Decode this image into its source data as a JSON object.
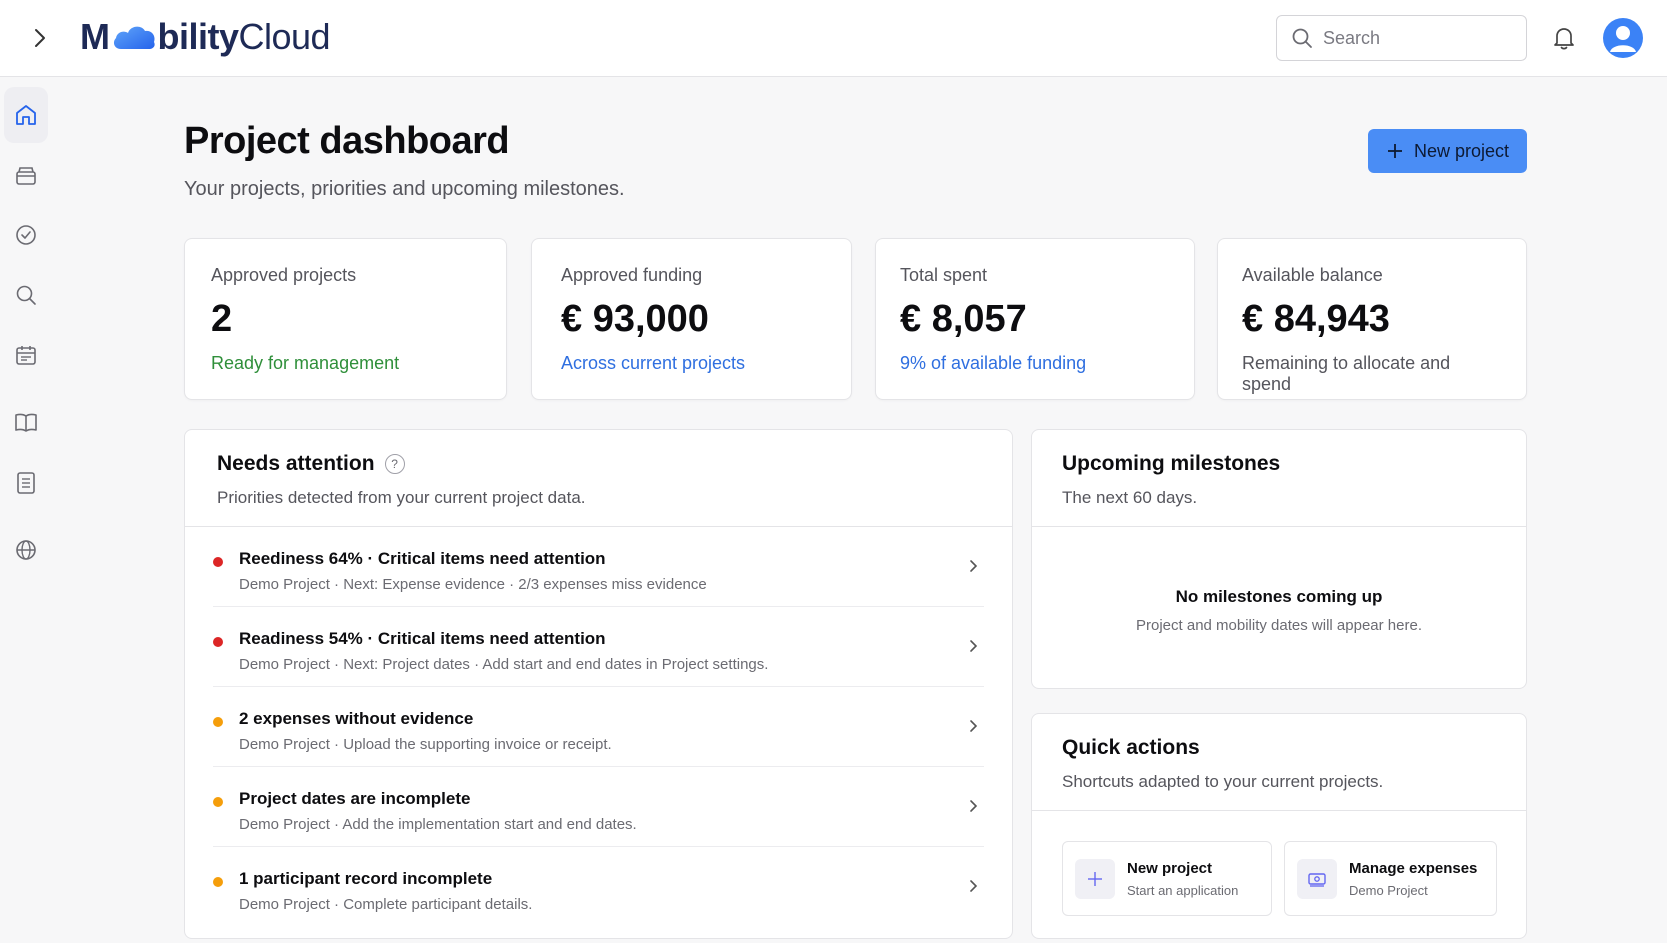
{
  "header": {
    "logo_bold": "M",
    "logo_bold_rest": "bility",
    "logo_light": "Cloud",
    "search_placeholder": "Search"
  },
  "page": {
    "title": "Project dashboard",
    "subtitle": "Your projects, priorities and upcoming milestones.",
    "new_project_label": "New project"
  },
  "stats": [
    {
      "label": "Approved projects",
      "value": "2",
      "note": "Ready for management",
      "note_color": "#2f8f3a"
    },
    {
      "label": "Approved funding",
      "value": "€ 93,000",
      "note": "Across current projects",
      "note_color": "#2f6fe0"
    },
    {
      "label": "Total spent",
      "value": "€ 8,057",
      "note": "9% of available funding",
      "note_color": "#2f6fe0"
    },
    {
      "label": "Available balance",
      "value": "€ 84,943",
      "note": "Remaining to allocate and spend",
      "note_color": "#55555c"
    }
  ],
  "attention": {
    "title": "Needs attention",
    "help": "?",
    "description": "Priorities detected from your current project data.",
    "items": [
      {
        "title": "Reediness 64% · Critical items need attention",
        "meta": "Demo Project · Next: Expense evidence · 2/3 expenses miss evidence",
        "severity_color": "#dc2626"
      },
      {
        "title": "Readiness 54% · Critical items need attention",
        "meta": "Demo Project · Next: Project dates · Add start and end dates in Project settings.",
        "severity_color": "#dc2626"
      },
      {
        "title": "2 expenses without evidence",
        "meta": "Demo Project · Upload the supporting invoice or receipt.",
        "severity_color": "#f59e0b"
      },
      {
        "title": "Project dates are incomplete",
        "meta": "Demo Project · Add the implementation start and end dates.",
        "severity_color": "#f59e0b"
      },
      {
        "title": "1 participant record incomplete",
        "meta": "Demo Project · Complete participant details.",
        "severity_color": "#f59e0b"
      }
    ]
  },
  "milestones": {
    "title": "Upcoming milestones",
    "description": "The next 60 days.",
    "empty_title": "No milestones coming up",
    "empty_desc": "Project and mobility dates will appear here."
  },
  "quick_actions": {
    "title": "Quick actions",
    "description": "Shortcuts adapted to your current projects.",
    "actions": [
      {
        "title": "New project",
        "sub": "Start an application",
        "icon": "plus-icon"
      },
      {
        "title": "Manage expenses",
        "sub": "Demo Project",
        "icon": "money-icon"
      }
    ]
  },
  "sidebar": {
    "items": [
      "home-icon",
      "inbox-icon",
      "check-circle-icon",
      "search-icon",
      "calendar-icon",
      "book-icon",
      "document-icon",
      "globe-icon"
    ]
  },
  "colors": {
    "accent": "#4a8df5",
    "danger": "#dc2626",
    "warning": "#f59e0b",
    "success": "#2f8f3a",
    "link": "#2f6fe0"
  }
}
